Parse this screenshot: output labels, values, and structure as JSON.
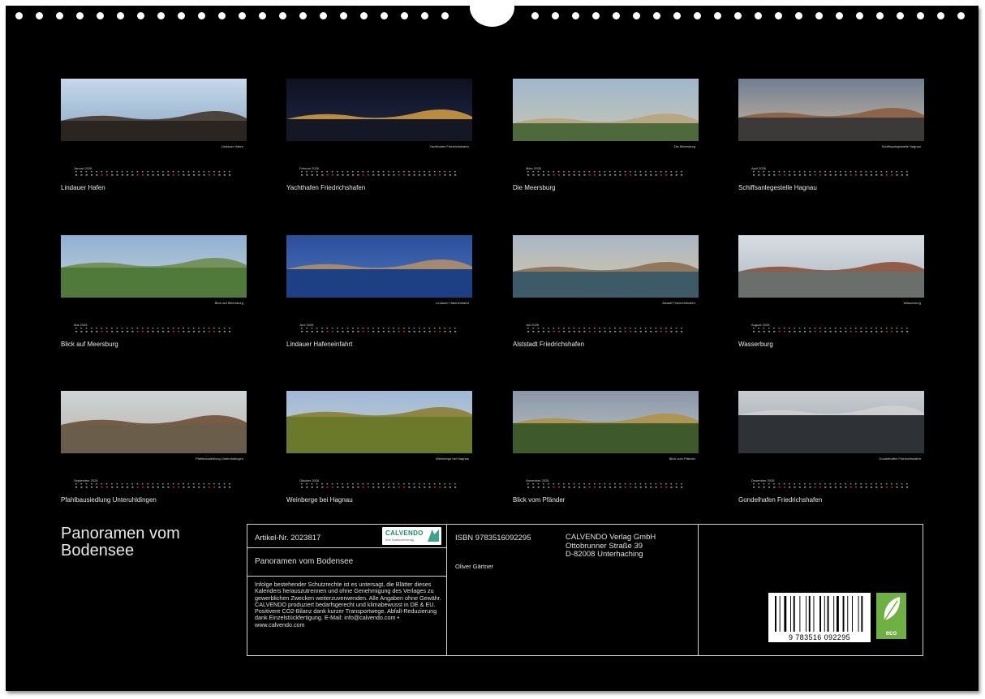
{
  "calendar": {
    "title_line1": "Panoramen vom",
    "title_line2": "Bodensee"
  },
  "months": [
    {
      "label": "Januar 2026",
      "caption": "Lindauer Hafen",
      "title": "Lindauer Hafen"
    },
    {
      "label": "Februar 2026",
      "caption": "Yachthafen Friedrichshafen",
      "title": "Yachthafen Friedrichshafen"
    },
    {
      "label": "März 2026",
      "caption": "Die Meersburg",
      "title": "Die Meersburg"
    },
    {
      "label": "April 2026",
      "caption": "Schiffsanlegestelle Hagnau",
      "title": "Schiffsanlegestelle Hagnau"
    },
    {
      "label": "Mai 2026",
      "caption": "Blick auf Meersburg",
      "title": "Blick auf Meersburg"
    },
    {
      "label": "Juni 2026",
      "caption": "Lindauer Hafeneinfahrt",
      "title": "Lindauer Hafeneinfahrt"
    },
    {
      "label": "Juli 2026",
      "caption": "Alstadt Friedrichshafen",
      "title": "Alststadt Friedrichshafen"
    },
    {
      "label": "August 2026",
      "caption": "Wasserburg",
      "title": "Wasserburg"
    },
    {
      "label": "September 2026",
      "caption": "Pfahlbausiedlung Unteruhldingen",
      "title": "Pfahlbausiedlung Unteruhldingen"
    },
    {
      "label": "Oktober 2026",
      "caption": "Weinberge bei Hagnau",
      "title": "Weinberge bei Hagnau"
    },
    {
      "label": "November 2026",
      "caption": "Blick vom Pfänder",
      "title": "Blick vom Pfänder"
    },
    {
      "label": "Dezember 2026",
      "caption": "Gondelhafen Friedrichshafen",
      "title": "Gondelhafen Friedrichshafen"
    }
  ],
  "info": {
    "article": "Artikel-Nr. 2023817",
    "logo_text": "CALVENDO",
    "logo_sub": "Ihre Kalenderverlag",
    "product_title": "Panoramen vom Bodensee",
    "legal": "Infolge bestehender Schutzrechte ist es untersagt, die Blätter dieses Kalenders herauszutrennen und ohne Genehmigung des Verlages zu gewerblichen Zwecken weiterzuverwenden. Alle Angaben ohne Gewähr. CALVENDO produziert bedarfsgerecht und klimabewusst in DE & EU. Positivere CO2-Bilanz dank kurzer Transportwege. Abfall-Reduzierung dank Einzelstückfertigung. E-Mail: info@calvendo.com • www.calvendo.com",
    "isbn": "ISBN 9783516092295",
    "author": "Oliver Gärtner",
    "publisher_line1": "CALVENDO Verlag GmbH",
    "publisher_line2": "Ottobrunner Straße 39",
    "publisher_line3": "D-82008 Unterhaching",
    "barcode_digits": "9 783516 092295",
    "eco_label": "eco"
  }
}
